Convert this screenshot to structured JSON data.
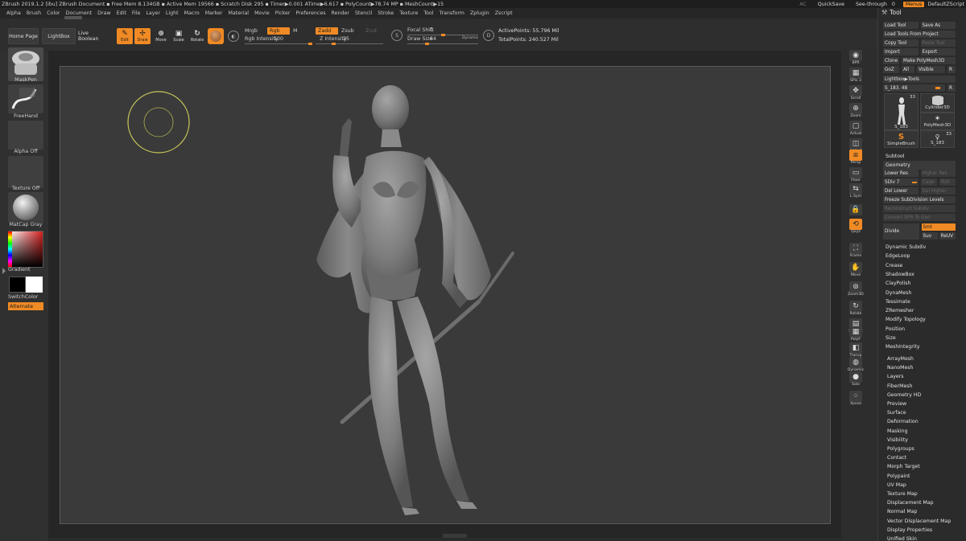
{
  "titlebar": {
    "title": "ZBrush 2019.1.2 [ibu]   ZBrush Document   ▪ Free Mem 8.134GB ▪ Active Mem 19566 ▪ Scratch Disk 295 ▪  Timer▶0.001 ATime▶6.617 ▪ PolyCount▶78.74 MP  ▪ MeshCount▶15",
    "ac": "AC",
    "quicksave": "QuickSave",
    "seethrough_label": "See-through",
    "seethrough_value": "0",
    "seethrough_level": 0,
    "menus": "Menus",
    "script": "DefaultZScript"
  },
  "menus": [
    "Alpha",
    "Brush",
    "Color",
    "Document",
    "Draw",
    "Edit",
    "File",
    "Layer",
    "Light",
    "Macro",
    "Marker",
    "Material",
    "Movie",
    "Picker",
    "Preferences",
    "Render",
    "Stencil",
    "Stroke",
    "Texture",
    "Tool",
    "Transform",
    "Zplugin",
    "Zscript"
  ],
  "shelf": {
    "home": "Home Page",
    "lightbox": "LightBox",
    "live_boolean": "Live Boolean",
    "tools": [
      {
        "label": "Edit",
        "active": true
      },
      {
        "label": "Draw",
        "active": true
      },
      {
        "label": "Move",
        "active": false
      },
      {
        "label": "Scale",
        "active": false
      },
      {
        "label": "Rotate",
        "active": false
      }
    ],
    "mrgb": "Mrgb",
    "rgb": "Rgb",
    "m": "M",
    "rgb_intensity_label": "Rgb Intensity",
    "rgb_intensity": "100",
    "rgb_intensity_level": 1.0,
    "zadd": "Zadd",
    "zsub": "Zsub",
    "zcut": "Zcut",
    "z_intensity_label": "Z Intensity",
    "z_intensity": "25",
    "z_intensity_level": 0.25,
    "focal_shift_label": "Focal Shift",
    "focal_shift": "0",
    "draw_size_label": "Draw Size",
    "draw_size": "64",
    "dynamic": "Dynamic",
    "active_points": "ActivePoints: 55.796 Mil",
    "total_points": "TotalPoints: 240.527 Mil"
  },
  "left_tray": [
    {
      "caption": "MaskPen",
      "icon": "brush-icon"
    },
    {
      "caption": "FreeHand",
      "icon": "stroke-icon"
    },
    {
      "caption": "Alpha Off",
      "icon": "alpha-icon"
    },
    {
      "caption": "Texture Off",
      "icon": "texture-icon"
    },
    {
      "caption": "MatCap Gray",
      "icon": "material-icon"
    }
  ],
  "color_tray": {
    "gradient": "Gradient",
    "switch_color": "SwitchColor",
    "alternate": "Alternate",
    "main_color": "#000000",
    "secondary_color": "#ffffff"
  },
  "right_shelf": [
    {
      "label": "BPR",
      "icon": "bpr-icon"
    },
    {
      "label": "SPix 3",
      "icon": "spix-icon"
    },
    {
      "label": "Scroll",
      "icon": "scroll-icon"
    },
    {
      "label": "Zoom",
      "icon": "zoom-icon"
    },
    {
      "label": "Actual",
      "icon": "actual-icon"
    },
    {
      "label": "AAHalf",
      "icon": "aahalf-icon"
    },
    {
      "label": "Persp",
      "icon": "persp-icon",
      "active": true
    },
    {
      "label": "Floor",
      "icon": "floor-icon"
    },
    {
      "label": "L.Sym",
      "icon": "lsym-icon"
    },
    {
      "label": "",
      "icon": "lock-icon"
    },
    {
      "label": "Qxyz",
      "icon": "xyz-icon",
      "active": true
    },
    {
      "label": "Frame",
      "icon": "frame-icon"
    },
    {
      "label": "Move",
      "icon": "move-icon"
    },
    {
      "label": "Zoom3D",
      "icon": "zoom3d-icon"
    },
    {
      "label": "Rotate",
      "icon": "rotate-icon"
    },
    {
      "label": "Line Fill",
      "icon": "linefill-icon"
    },
    {
      "label": "PolyF",
      "icon": "polyf-icon"
    },
    {
      "label": "Transp",
      "icon": "transp-icon"
    },
    {
      "label": "Dynamic",
      "icon": "dynamic-icon"
    },
    {
      "label": "Solo",
      "icon": "solo-icon"
    },
    {
      "label": "Xpose",
      "icon": "xpose-icon"
    }
  ],
  "palette": {
    "title": "Tool",
    "load_tool": "Load Tool",
    "save_as": "Save As",
    "load_from_project": "Load Tools From Project",
    "copy_tool": "Copy Tool",
    "paste_tool": "Paste Tool",
    "import": "Import",
    "export": "Export",
    "clone": "Clone",
    "make_polymesh": "Make PolyMesh3D",
    "goz": "GoZ",
    "all": "All",
    "visible": "Visible",
    "r": "R",
    "lightbox_tools": "Lightbox▶Tools",
    "current_tool": "S_183. 48",
    "thumbs": [
      {
        "name": "S_183",
        "count": "33"
      },
      {
        "name": "Cylinder3D",
        "count": ""
      },
      {
        "name": "PolyMesh3D",
        "count": ""
      },
      {
        "name": "SimpleBrush",
        "count": ""
      },
      {
        "name": "S_183",
        "count": "33"
      }
    ],
    "subtool": "Subtool",
    "geometry": "Geometry",
    "lower_res": "Lower Res",
    "higher_res": "Higher Res",
    "sdiv": "SDiv 7",
    "cage": "Cage",
    "rstr": "Rstr",
    "del_lower": "Del Lower",
    "del_higher": "Del Higher",
    "freeze_subdiv": "Freeze SubDivision Levels",
    "reconstruct_subdiv": "Reconstruct Subdiv",
    "convert_bpr": "Convert BPR To Geo",
    "divide": "Divide",
    "smt": "Smt",
    "suv": "Suv",
    "reuv": "ReUV",
    "geometry_items": [
      "Dynamic Subdiv",
      "EdgeLoop",
      "Crease",
      "ShadowBox",
      "ClayPolish",
      "DynaMesh",
      "Tessimate",
      "ZRemesher",
      "Modify Topology",
      "Position",
      "Size",
      "MeshIntegrity"
    ],
    "sections": [
      "ArrayMesh",
      "NanoMesh",
      "Layers",
      "FiberMesh",
      "Geometry HD",
      "Preview",
      "Surface",
      "Deformation",
      "Masking",
      "Visibility",
      "Polygroups",
      "Contact",
      "Morph Target",
      "Polypaint",
      "UV Map",
      "Texture Map",
      "Displacement Map",
      "Normal Map",
      "Vector Displacement Map",
      "Display Properties",
      "Unified Skin"
    ]
  }
}
